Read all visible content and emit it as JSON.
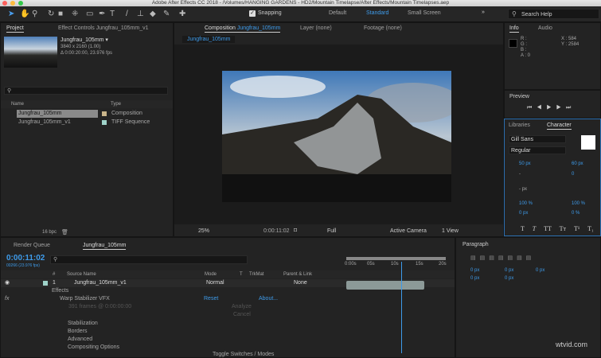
{
  "window": {
    "title": "Adobe After Effects CC 2018 - /Volumes/HANGING GARDENS - HD2/Mountain Timelapse/After Effects/Mountain Timelapses.aep"
  },
  "toolbar": {
    "snapping": "Snapping",
    "workspaces": [
      "Default",
      "Standard",
      "Small Screen"
    ],
    "active_workspace": "Standard",
    "search_placeholder": "Search Help"
  },
  "project": {
    "tab": "Project",
    "effect_controls_tab": "Effect Controls Jungfrau_105mm_v1",
    "item_name": "Jungfrau_105mm ▾",
    "item_res": "3840 x 2160 (1.00)",
    "item_dur": "Δ 0:00:20:00, 23.976 fps",
    "col_name": "Name",
    "col_type": "Type",
    "rows": [
      {
        "name": "Jungfrau_105mm",
        "type": "Composition",
        "color": "#c9b48a"
      },
      {
        "name": "Jungfrau_105mm_v1",
        "type": "TIFF Sequence",
        "color": "#9fd3c9"
      }
    ],
    "bpc": "16 bpc"
  },
  "composition": {
    "tab_prefix": "Composition",
    "tab_name": "Jungfrau_105mm",
    "layer_tab": "Layer (none)",
    "footage_tab": "Footage (none)",
    "subtab": "Jungfrau_105mm",
    "zoom": "25%",
    "timecode": "0:00:11:02",
    "resolution": "Full",
    "camera": "Active Camera",
    "views": "1 View"
  },
  "info": {
    "tab": "Info",
    "audio_tab": "Audio",
    "r": "R :",
    "g": "G :",
    "b": "B :",
    "a": "A : 0",
    "x": "X : 584",
    "y": "Y : 2584"
  },
  "preview": {
    "tab": "Preview"
  },
  "character": {
    "libraries_tab": "Libraries",
    "tab": "Character",
    "font": "Gill Sans",
    "style": "Regular",
    "size": "50 px",
    "leading": "60 px",
    "kerning": "-",
    "tracking": "0",
    "stroke": "- px",
    "vscale": "100 %",
    "hscale": "100 %",
    "baseline": "0 px",
    "tsume": "0 %",
    "styles": [
      "T",
      "T",
      "TT",
      "Tт",
      "T¹",
      "T₁"
    ]
  },
  "timeline": {
    "render_tab": "Render Queue",
    "comp_tab": "Jungfrau_105mm",
    "timecode": "0:00:11:02",
    "frames": "00266 (23.976 fps)",
    "cols": {
      "num": "#",
      "source": "Source Name",
      "mode": "Mode",
      "t": "T",
      "trkmat": "TrkMat",
      "parent": "Parent & Link"
    },
    "layer": {
      "num": "1",
      "name": "Jungfrau_105mm_v1",
      "mode": "Normal",
      "parent": "None"
    },
    "effects": "Effects",
    "effect_name": "Warp Stabilizer VFX",
    "reset": "Reset",
    "about": "About...",
    "frames_info": "391 frames @ 0:00:00:00",
    "analyze": "Analyze",
    "cancel": "Cancel",
    "groups": [
      "Stabilization",
      "Borders",
      "Advanced",
      "Compositing Options"
    ],
    "toggle": "Toggle Switches / Modes",
    "ruler": [
      "0:00s",
      "05s",
      "10s",
      "15s",
      "20s"
    ],
    "playhead_fraction": 0.55
  },
  "paragraph": {
    "tab": "Paragraph",
    "values": [
      "0 px",
      "0 px",
      "0 px",
      "0 px",
      "0 px"
    ]
  },
  "watermark": "wtvid.com"
}
